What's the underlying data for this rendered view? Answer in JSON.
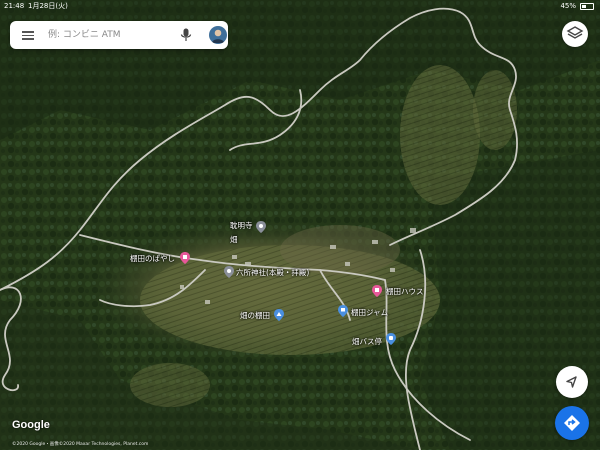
{
  "status_bar": {
    "time": "21:48",
    "date": "1月28日(火)",
    "battery": "45%"
  },
  "search": {
    "placeholder": "例: コンビニ ATM"
  },
  "map": {
    "colors": {
      "forest": "#24361a",
      "forest_dark": "#152212",
      "terrace": "#5d6438",
      "road": "#c8c8c0",
      "pin_pink": "#e8589a",
      "pin_blue": "#4a8fe0"
    },
    "places": [
      {
        "name": "棚田のぱやし",
        "icon": "shop-pin-icon",
        "color": "pink"
      },
      {
        "name": "棚田ハウス",
        "icon": "shop-pin-icon",
        "color": "pink"
      },
      {
        "name": "六所神社(本殿・拝殿)",
        "icon": "temple-pin-icon",
        "color": "gray"
      },
      {
        "name": "耽明寺",
        "icon": "temple-pin-icon",
        "color": "gray"
      },
      {
        "name": "棚田ジャム",
        "icon": "cafe-pin-icon",
        "color": "blue"
      },
      {
        "name": "畑の棚田",
        "icon": "mountain-pin-icon",
        "color": "blue"
      },
      {
        "name": "畑バス停",
        "icon": "bus-pin-icon",
        "color": "blue"
      },
      {
        "name": "畑",
        "icon": "",
        "color": "none"
      }
    ]
  },
  "logo": "Google",
  "attribution": "©2020 Google・画像©2020 Maxar Technologies, Planet.com"
}
